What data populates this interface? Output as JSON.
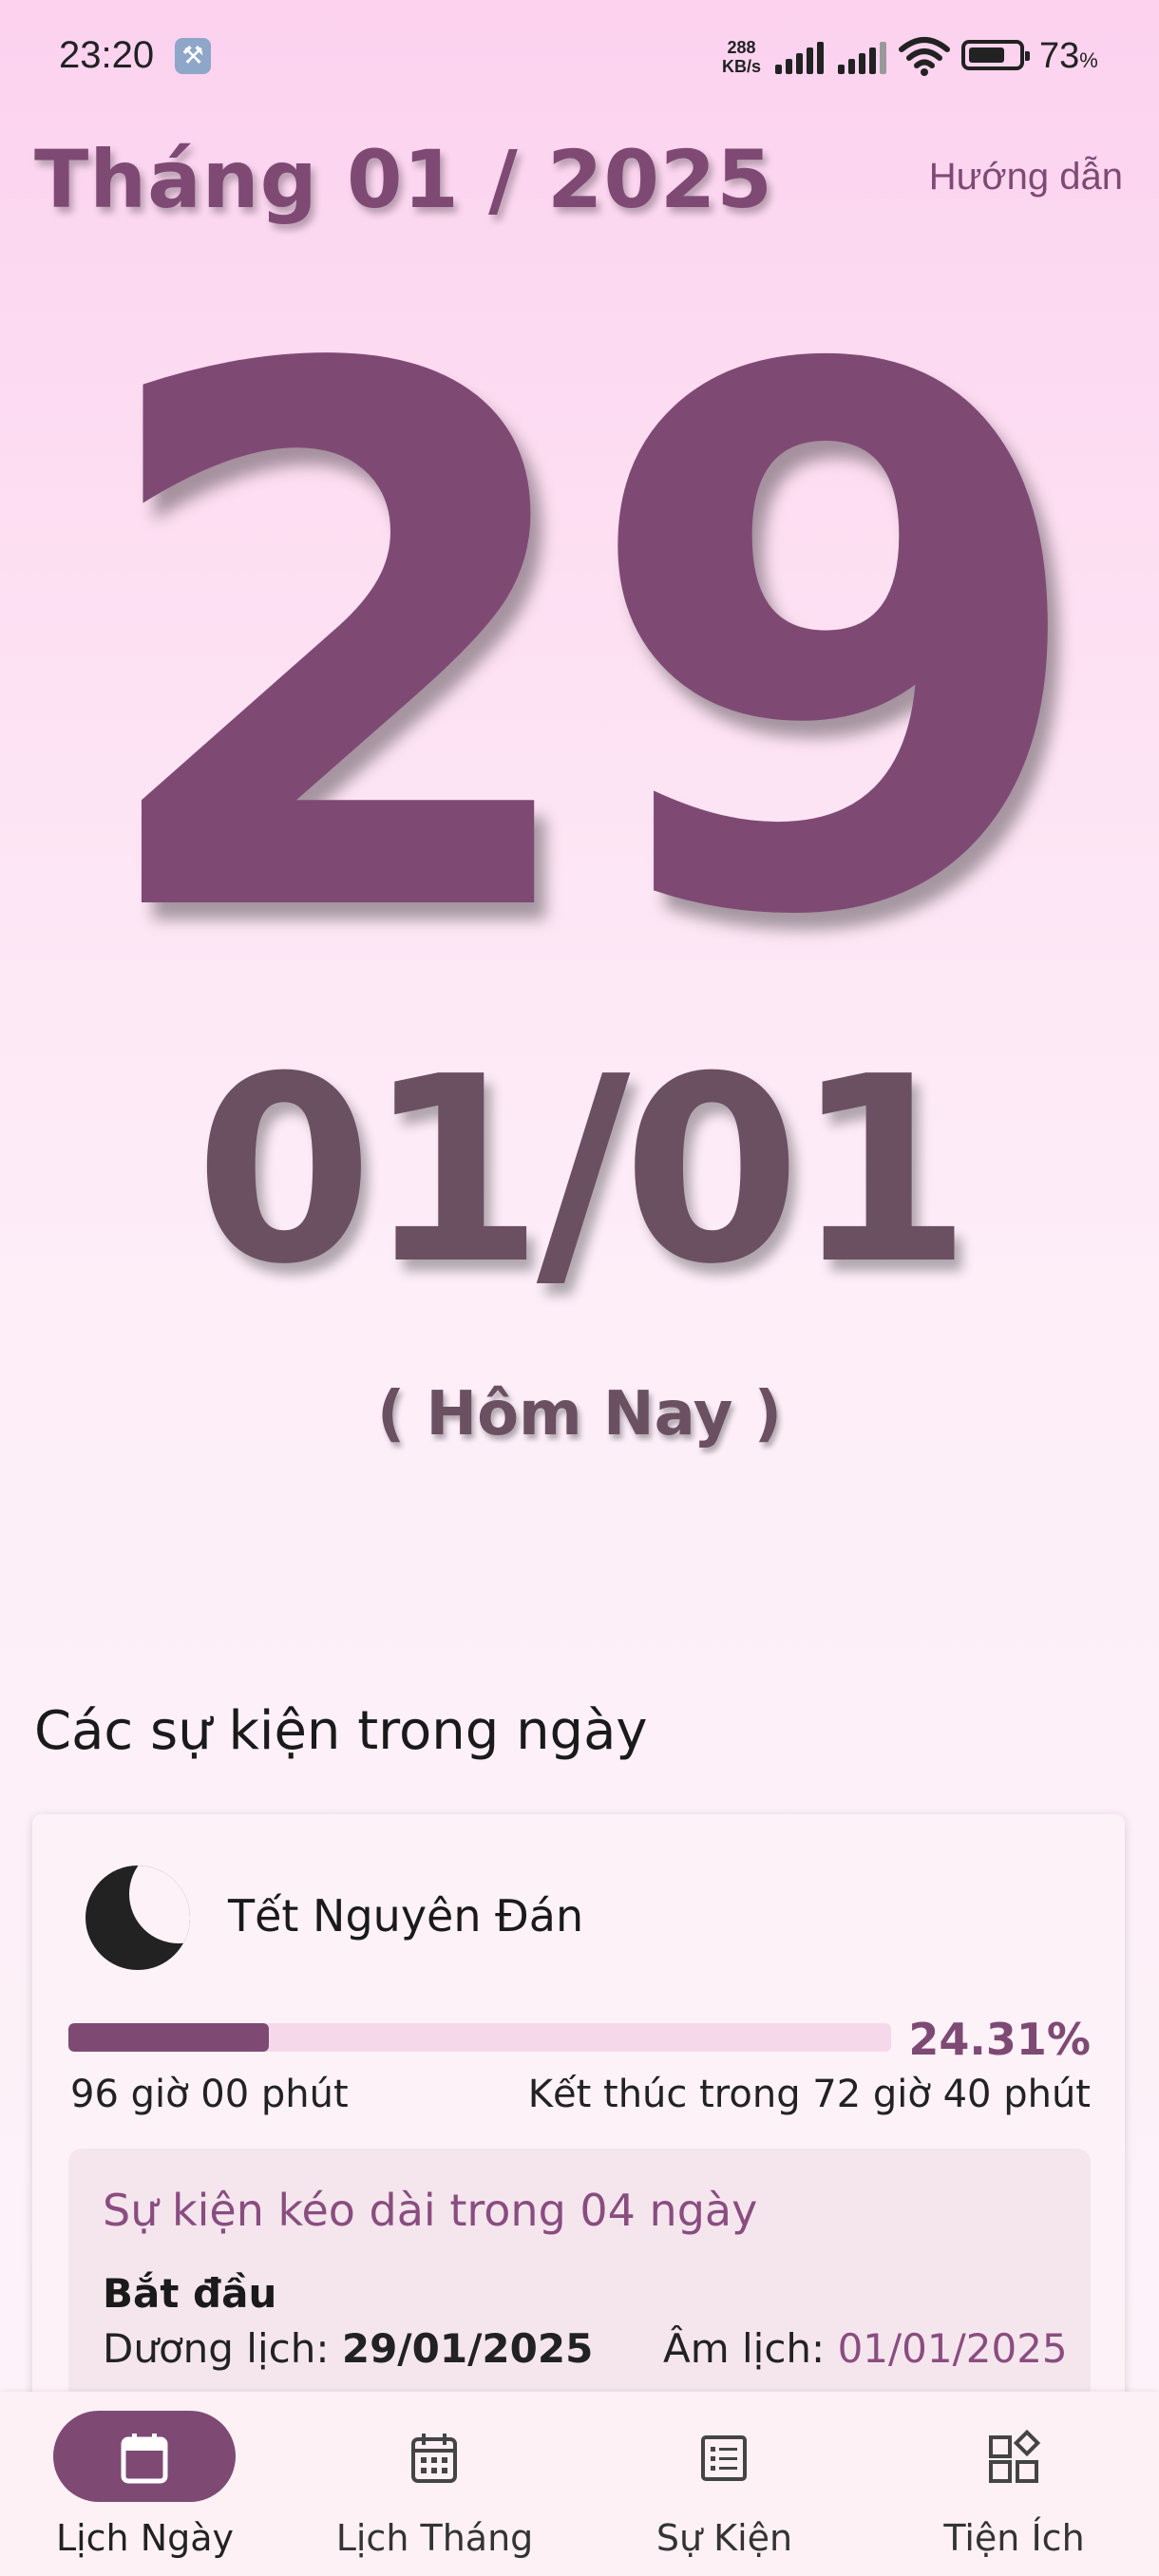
{
  "status_bar": {
    "time": "23:20",
    "net_speed_value": "288",
    "net_speed_unit": "KB/s",
    "battery_percent": "73",
    "battery_suffix": "%",
    "battery_level": 0.73
  },
  "header": {
    "month_title": "Tháng 01 / 2025",
    "guide_link": "Hướng dẫn"
  },
  "day": {
    "solar_day": "29",
    "lunar_date": "01/01",
    "today_label": "( Hôm Nay )"
  },
  "events_section": {
    "title": "Các sự kiện trong ngày",
    "events": [
      {
        "icon": "moon-icon",
        "name": "Tết Nguyên Đán",
        "progress_percent": 24.31,
        "progress_label": "24.31%",
        "elapsed": "96 giờ 00 phút",
        "remaining": "Kết thúc trong 72 giờ 40 phút",
        "duration": "Sự kiện kéo dài trong 04 ngày",
        "start_label": "Bắt đầu",
        "solar_label": "Dương lịch:",
        "solar_date": "29/01/2025",
        "lunar_label": "Âm lịch:",
        "lunar_date": "01/01/2025"
      }
    ]
  },
  "bottom_nav": {
    "items": [
      {
        "label": "Lịch Ngày",
        "icon": "calendar-icon",
        "active": true
      },
      {
        "label": "Lịch Tháng",
        "icon": "calendar-month-icon",
        "active": false
      },
      {
        "label": "Sự Kiện",
        "icon": "event-list-icon",
        "active": false
      },
      {
        "label": "Tiện Ích",
        "icon": "widgets-icon",
        "active": false
      }
    ]
  },
  "colors": {
    "accent": "#7e4a74",
    "lunar_text": "#6b5062",
    "progress_track": "#f5d9eb"
  }
}
